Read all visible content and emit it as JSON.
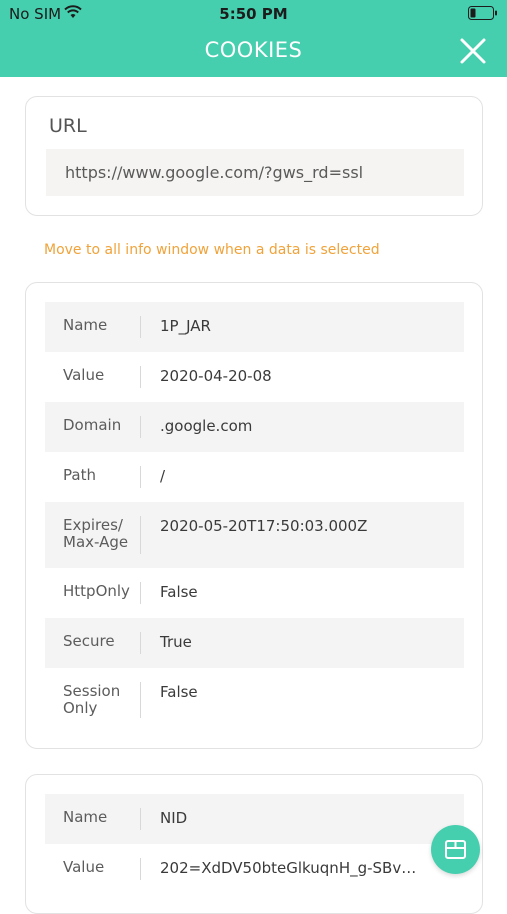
{
  "status_bar": {
    "carrier": "No SIM",
    "time": "5:50 PM"
  },
  "header": {
    "title": "COOKIES"
  },
  "url_section": {
    "label": "URL",
    "value": "https://www.google.com/?gws_rd=ssl"
  },
  "hint": "Move to all info window when a data is selected",
  "cookies": [
    {
      "rows": [
        {
          "key": "Name",
          "value": "1P_JAR"
        },
        {
          "key": "Value",
          "value": "2020-04-20-08"
        },
        {
          "key": "Domain",
          "value": ".google.com"
        },
        {
          "key": "Path",
          "value": "/"
        },
        {
          "key": "Expires/ Max-Age",
          "value": "2020-05-20T17:50:03.000Z"
        },
        {
          "key": "HttpOnly",
          "value": "False"
        },
        {
          "key": "Secure",
          "value": "True"
        },
        {
          "key": "Session Only",
          "value": "False"
        }
      ]
    },
    {
      "rows": [
        {
          "key": "Name",
          "value": "NID"
        },
        {
          "key": "Value",
          "value": "202=XdDV50bteGlkuqnH_g-SBv…"
        }
      ]
    }
  ],
  "colors": {
    "accent": "#45cfae",
    "hint": "#f0a33a",
    "row_shade": "#f4f4f4"
  },
  "icons": {
    "close": "close-icon",
    "fab": "box-icon",
    "wifi": "wifi-icon",
    "battery": "battery-icon"
  }
}
